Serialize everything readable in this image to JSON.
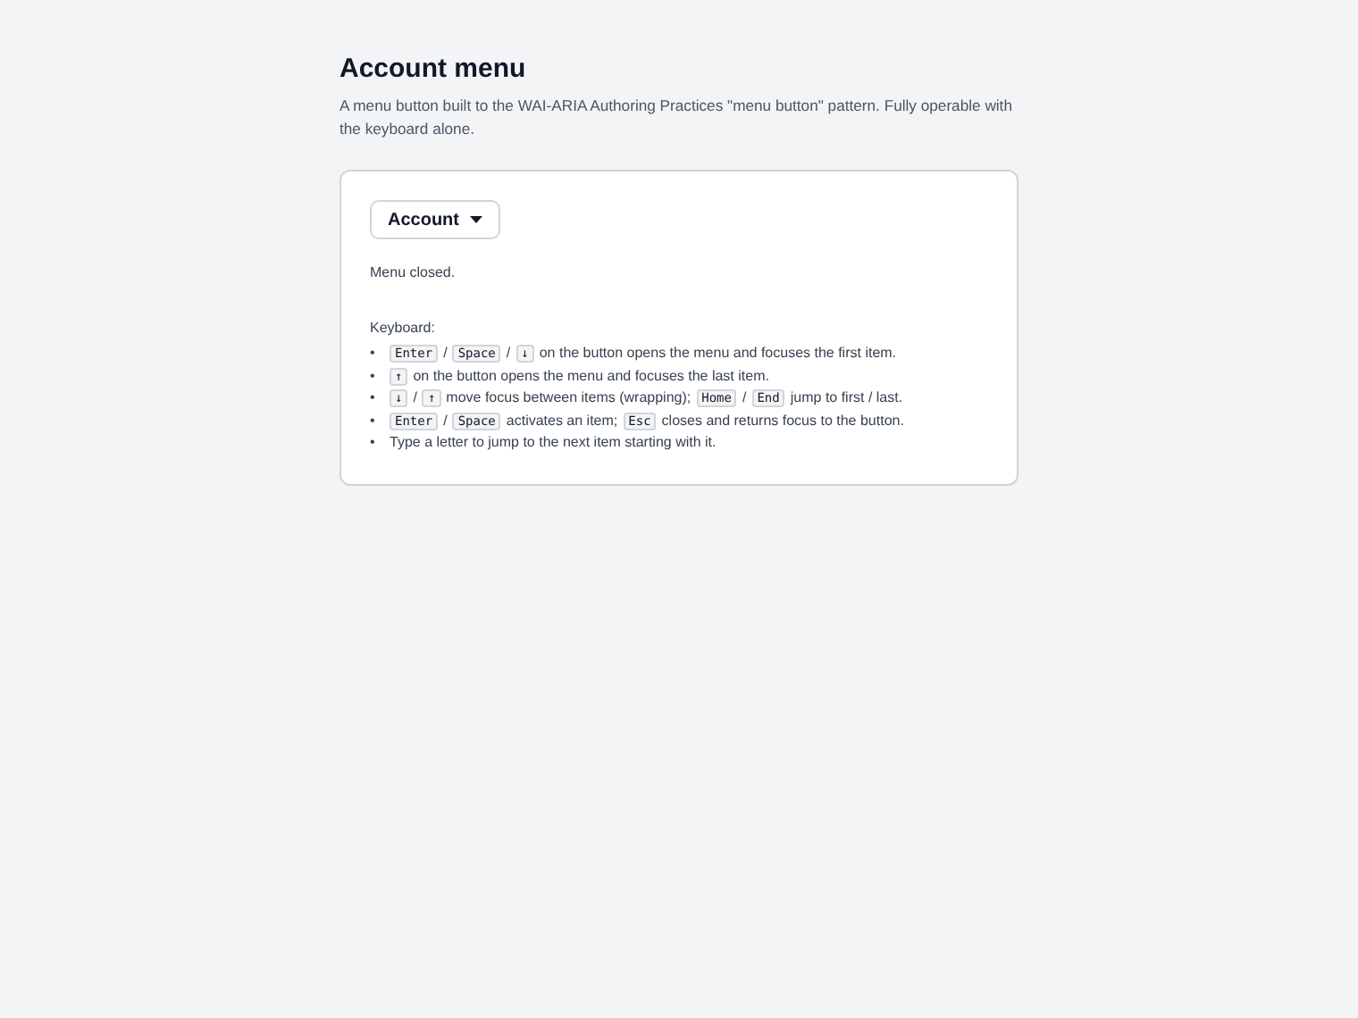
{
  "title": "Account menu",
  "description": "A menu button built to the WAI-ARIA Authoring Practices \"menu button\" pattern. Fully operable with the keyboard alone.",
  "menu_button": {
    "label": "Account",
    "expanded": false
  },
  "status": "Menu closed.",
  "keyboard_heading": "Keyboard:",
  "keyboard_help": [
    {
      "marker": "•",
      "parts": [
        {
          "kind": "key",
          "text": "Enter"
        },
        {
          "kind": "text",
          "text": "/"
        },
        {
          "kind": "key",
          "text": "Space"
        },
        {
          "kind": "text",
          "text": "/"
        },
        {
          "kind": "key",
          "text": "↓"
        },
        {
          "kind": "text",
          "text": "on the button opens the menu and focuses the first item."
        }
      ]
    },
    {
      "marker": "•",
      "parts": [
        {
          "kind": "key",
          "text": "↑"
        },
        {
          "kind": "text",
          "text": "on the button opens the menu and focuses the last item."
        }
      ]
    },
    {
      "marker": "•",
      "parts": [
        {
          "kind": "key",
          "text": "↓"
        },
        {
          "kind": "text",
          "text": "/"
        },
        {
          "kind": "key",
          "text": "↑"
        },
        {
          "kind": "text",
          "text": "move focus between items (wrapping);"
        },
        {
          "kind": "key",
          "text": "Home"
        },
        {
          "kind": "text",
          "text": "/"
        },
        {
          "kind": "key",
          "text": "End"
        },
        {
          "kind": "text",
          "text": "jump to first / last."
        }
      ]
    },
    {
      "marker": "•",
      "parts": [
        {
          "kind": "key",
          "text": "Enter"
        },
        {
          "kind": "text",
          "text": "/"
        },
        {
          "kind": "key",
          "text": "Space"
        },
        {
          "kind": "text",
          "text": "activates an item;"
        },
        {
          "kind": "key",
          "text": "Esc"
        },
        {
          "kind": "text",
          "text": "closes and returns focus to the button."
        }
      ]
    },
    {
      "marker": "•",
      "parts": [
        {
          "kind": "text",
          "text": "Type a letter to jump to the next item starting with it."
        }
      ]
    }
  ]
}
